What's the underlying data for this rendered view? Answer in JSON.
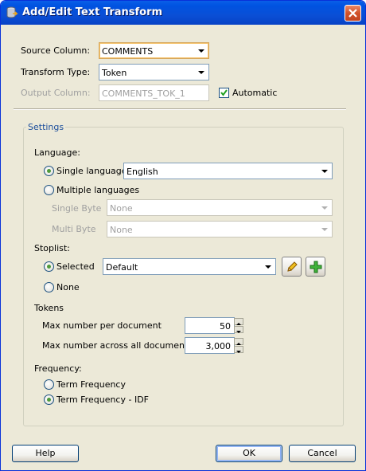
{
  "window": {
    "title": "Add/Edit Text Transform",
    "icon": "database-transform-icon",
    "accent": "#0a4fd6"
  },
  "form": {
    "source_column_label": "Source Column:",
    "source_column_value": "COMMENTS",
    "transform_type_label": "Transform Type:",
    "transform_type_value": "Token",
    "output_column_label": "Output Column:",
    "output_column_value": "COMMENTS_TOK_1",
    "automatic_label": "Automatic",
    "automatic_checked": true
  },
  "settings": {
    "title": "Settings",
    "language_label": "Language:",
    "single_language_label": "Single language",
    "single_language_value": "English",
    "multiple_languages_label": "Multiple languages",
    "single_byte_label": "Single Byte",
    "single_byte_value": "None",
    "multi_byte_label": "Multi Byte",
    "multi_byte_value": "None",
    "stoplist_label": "Stoplist:",
    "selected_label": "Selected",
    "stoplist_value": "Default",
    "none_label": "None",
    "tokens_label": "Tokens",
    "max_per_doc_label": "Max number per document",
    "max_per_doc_value": "50",
    "max_all_docs_label": "Max number across all documents",
    "max_all_docs_value": "3,000",
    "frequency_label": "Frequency:",
    "term_frequency_label": "Term Frequency",
    "term_frequency_idf_label": "Term Frequency - IDF"
  },
  "buttons": {
    "help_label": "Help",
    "ok_label": "OK",
    "cancel_label": "Cancel"
  }
}
